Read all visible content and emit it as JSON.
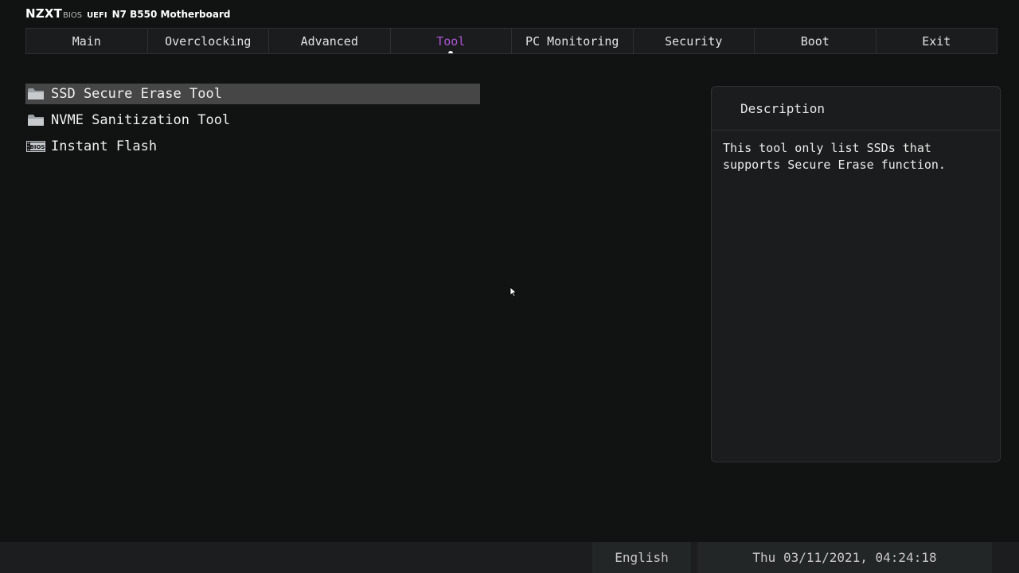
{
  "brand": {
    "logo": "NZXT",
    "bios": "BIOS",
    "uefi": "UEFI",
    "model": "N7 B550 Motherboard"
  },
  "tabs": [
    {
      "label": "Main",
      "active": false
    },
    {
      "label": "Overclocking",
      "active": false
    },
    {
      "label": "Advanced",
      "active": false
    },
    {
      "label": "Tool",
      "active": true
    },
    {
      "label": "PC Monitoring",
      "active": false
    },
    {
      "label": "Security",
      "active": false
    },
    {
      "label": "Boot",
      "active": false
    },
    {
      "label": "Exit",
      "active": false
    }
  ],
  "menu": {
    "items": [
      {
        "label": "SSD Secure Erase Tool",
        "icon": "folder-icon",
        "selected": true
      },
      {
        "label": "NVME Sanitization Tool",
        "icon": "folder-icon",
        "selected": false
      },
      {
        "label": "Instant Flash",
        "icon": "bios-chip-icon",
        "icon_text": "BIOS",
        "selected": false
      }
    ]
  },
  "description": {
    "title": "Description",
    "text": "This tool only list SSDs that\nsupports Secure Erase function."
  },
  "status": {
    "language": "English",
    "datetime": "Thu 03/11/2021, 04:24:18"
  },
  "colors": {
    "accent": "#b055d6",
    "background": "#111212",
    "selection": "#464646"
  }
}
